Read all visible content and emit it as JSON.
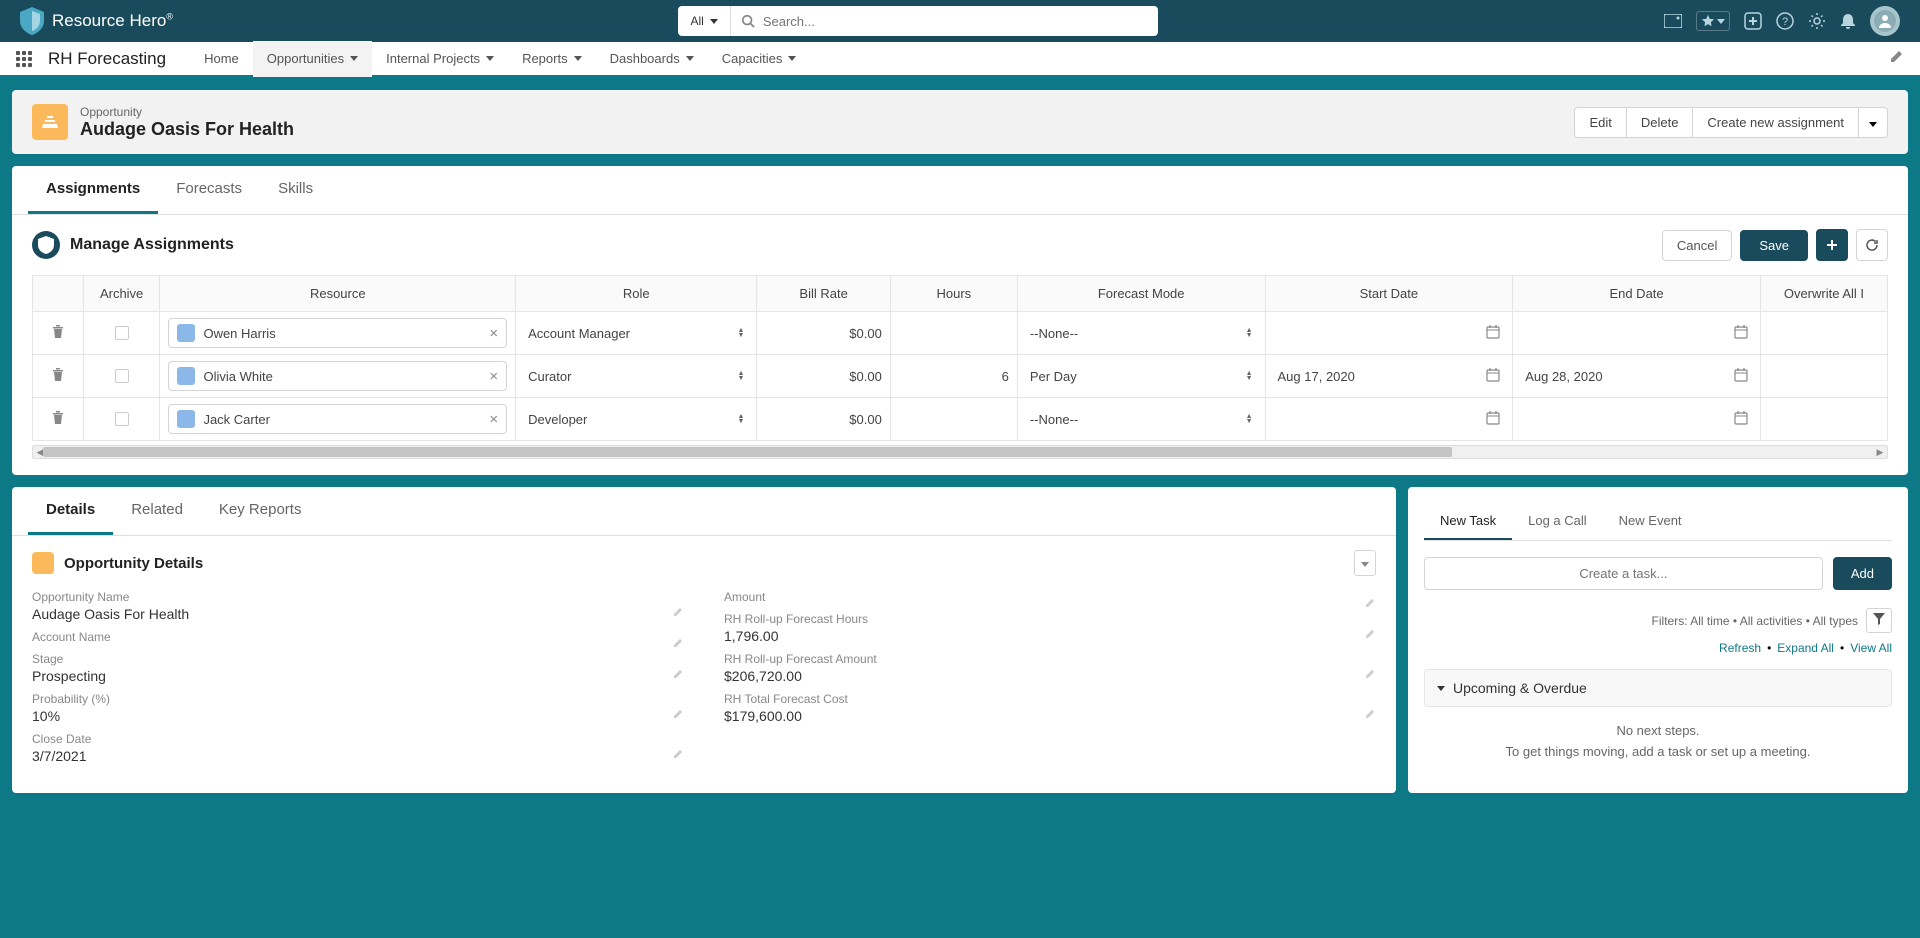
{
  "brand": "Resource Hero",
  "search": {
    "filter": "All",
    "placeholder": "Search..."
  },
  "nav": {
    "appName": "RH Forecasting",
    "items": [
      "Home",
      "Opportunities",
      "Internal Projects",
      "Reports",
      "Dashboards",
      "Capacities"
    ]
  },
  "record": {
    "type": "Opportunity",
    "title": "Audage Oasis For Health",
    "actions": {
      "edit": "Edit",
      "delete": "Delete",
      "create": "Create new assignment"
    }
  },
  "mainTabs": [
    "Assignments",
    "Forecasts",
    "Skills"
  ],
  "manage": {
    "title": "Manage Assignments",
    "cancel": "Cancel",
    "save": "Save"
  },
  "table": {
    "headers": {
      "archive": "Archive",
      "resource": "Resource",
      "role": "Role",
      "billRate": "Bill Rate",
      "hours": "Hours",
      "forecastMode": "Forecast Mode",
      "startDate": "Start Date",
      "endDate": "End Date",
      "overwrite": "Overwrite All I"
    },
    "rows": [
      {
        "resource": "Owen Harris",
        "role": "Account Manager",
        "billRate": "$0.00",
        "hours": "",
        "forecastMode": "--None--",
        "startDate": "",
        "endDate": ""
      },
      {
        "resource": "Olivia White",
        "role": "Curator",
        "billRate": "$0.00",
        "hours": "6",
        "forecastMode": "Per Day",
        "startDate": "Aug 17, 2020",
        "endDate": "Aug 28, 2020"
      },
      {
        "resource": "Jack Carter",
        "role": "Developer",
        "billRate": "$0.00",
        "hours": "",
        "forecastMode": "--None--",
        "startDate": "",
        "endDate": ""
      }
    ]
  },
  "detailsTabs": [
    "Details",
    "Related",
    "Key Reports"
  ],
  "details": {
    "sectionTitle": "Opportunity Details",
    "left": [
      {
        "label": "Opportunity Name",
        "value": "Audage Oasis For Health"
      },
      {
        "label": "Account Name",
        "value": ""
      },
      {
        "label": "Stage",
        "value": "Prospecting"
      },
      {
        "label": "Probability (%)",
        "value": "10%"
      },
      {
        "label": "Close Date",
        "value": "3/7/2021"
      }
    ],
    "right": [
      {
        "label": "Amount",
        "value": ""
      },
      {
        "label": "RH Roll-up Forecast Hours",
        "value": "1,796.00"
      },
      {
        "label": "RH Roll-up Forecast Amount",
        "value": "$206,720.00"
      },
      {
        "label": "RH Total Forecast Cost",
        "value": "$179,600.00"
      }
    ]
  },
  "activity": {
    "tabs": [
      "New Task",
      "Log a Call",
      "New Event"
    ],
    "taskPlaceholder": "Create a task...",
    "addBtn": "Add",
    "filterText": "Filters: All time • All activities • All types",
    "links": {
      "refresh": "Refresh",
      "expand": "Expand All",
      "viewAll": "View All"
    },
    "upcoming": "Upcoming & Overdue",
    "noSteps1": "No next steps.",
    "noSteps2": "To get things moving, add a task or set up a meeting."
  }
}
